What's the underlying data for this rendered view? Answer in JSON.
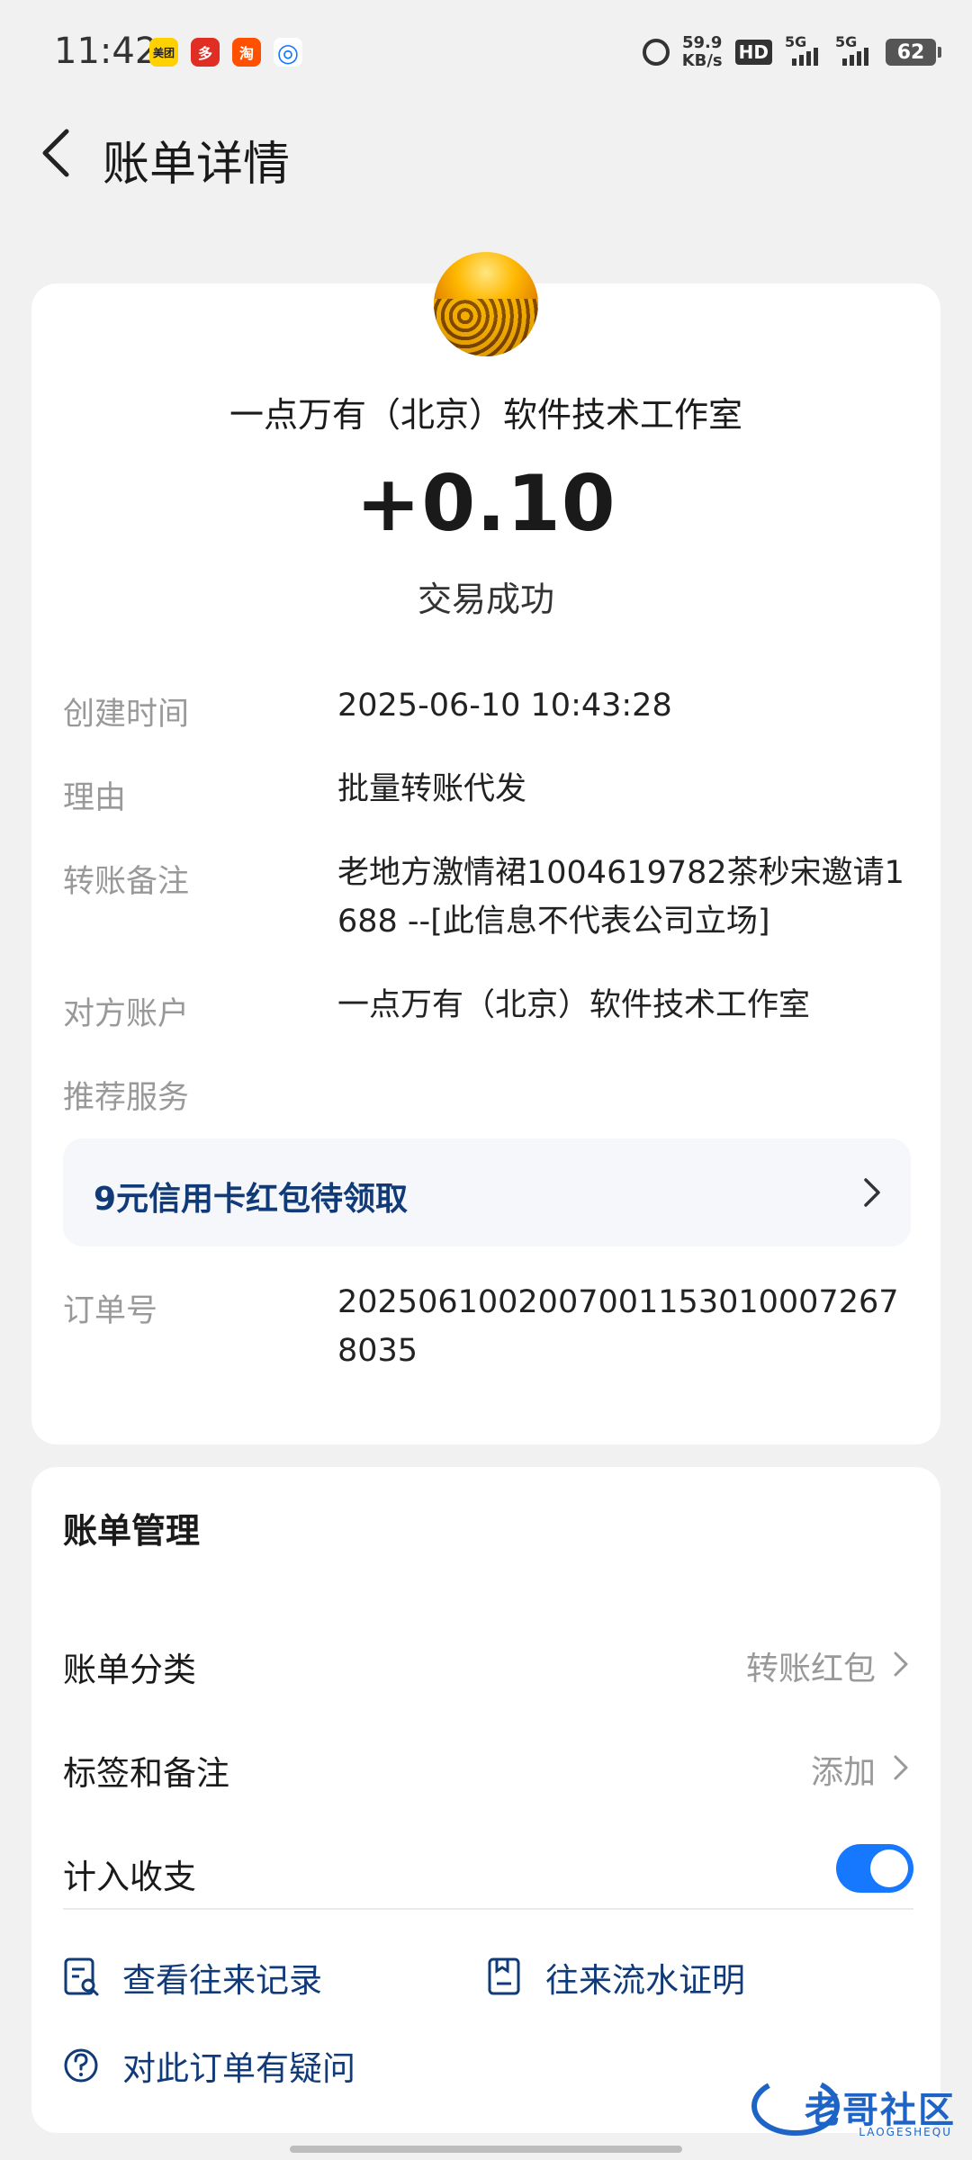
{
  "status_bar": {
    "time": "11:42",
    "apps": [
      {
        "name": "meituan-app-icon",
        "label": "美团",
        "color": "#ffd100"
      },
      {
        "name": "pinduoduo-app-icon",
        "label": "多",
        "color": "#e02e24"
      },
      {
        "name": "taobao-app-icon",
        "label": "淘",
        "color": "#ff5000"
      },
      {
        "name": "browser-app-icon",
        "label": "◎",
        "color": "#1677ff"
      }
    ],
    "net_speed_value": "59.9",
    "net_speed_unit": "KB/s",
    "hd_label": "HD",
    "sim1_label": "5G",
    "sim2_label": "5G",
    "battery": "62"
  },
  "header": {
    "title": "账单详情"
  },
  "bill": {
    "merchant": "一点万有（北京）软件技术工作室",
    "amount": "+0.10",
    "status": "交易成功",
    "fields": [
      {
        "label": "创建时间",
        "value": "2025-06-10 10:43:28"
      },
      {
        "label": "理由",
        "value": "批量转账代发"
      },
      {
        "label": "转账备注",
        "value": "老地方激情裙1004619782茶秒宋邀请1688 --[此信息不代表公司立场]"
      },
      {
        "label": "对方账户",
        "value": "一点万有（北京）软件技术工作室"
      },
      {
        "label": "推荐服务",
        "value": ""
      },
      {
        "label": "订单号",
        "value": "20250610020070011530100072678035"
      }
    ],
    "promo": "9元信用卡红包待领取"
  },
  "management": {
    "title": "账单管理",
    "category_label": "账单分类",
    "category_value": "转账红包",
    "tags_label": "标签和备注",
    "tags_value": "添加",
    "include_label": "计入收支",
    "include_on": true,
    "actions": {
      "history": "查看往来记录",
      "proof": "往来流水证明",
      "question": "对此订单有疑问"
    }
  },
  "watermark": {
    "text": "老哥社区",
    "sub": "LAOGESHEQU"
  },
  "colors": {
    "accent": "#1677ff",
    "link": "#103a78",
    "muted": "#999999",
    "background": "#f1f1f1"
  }
}
